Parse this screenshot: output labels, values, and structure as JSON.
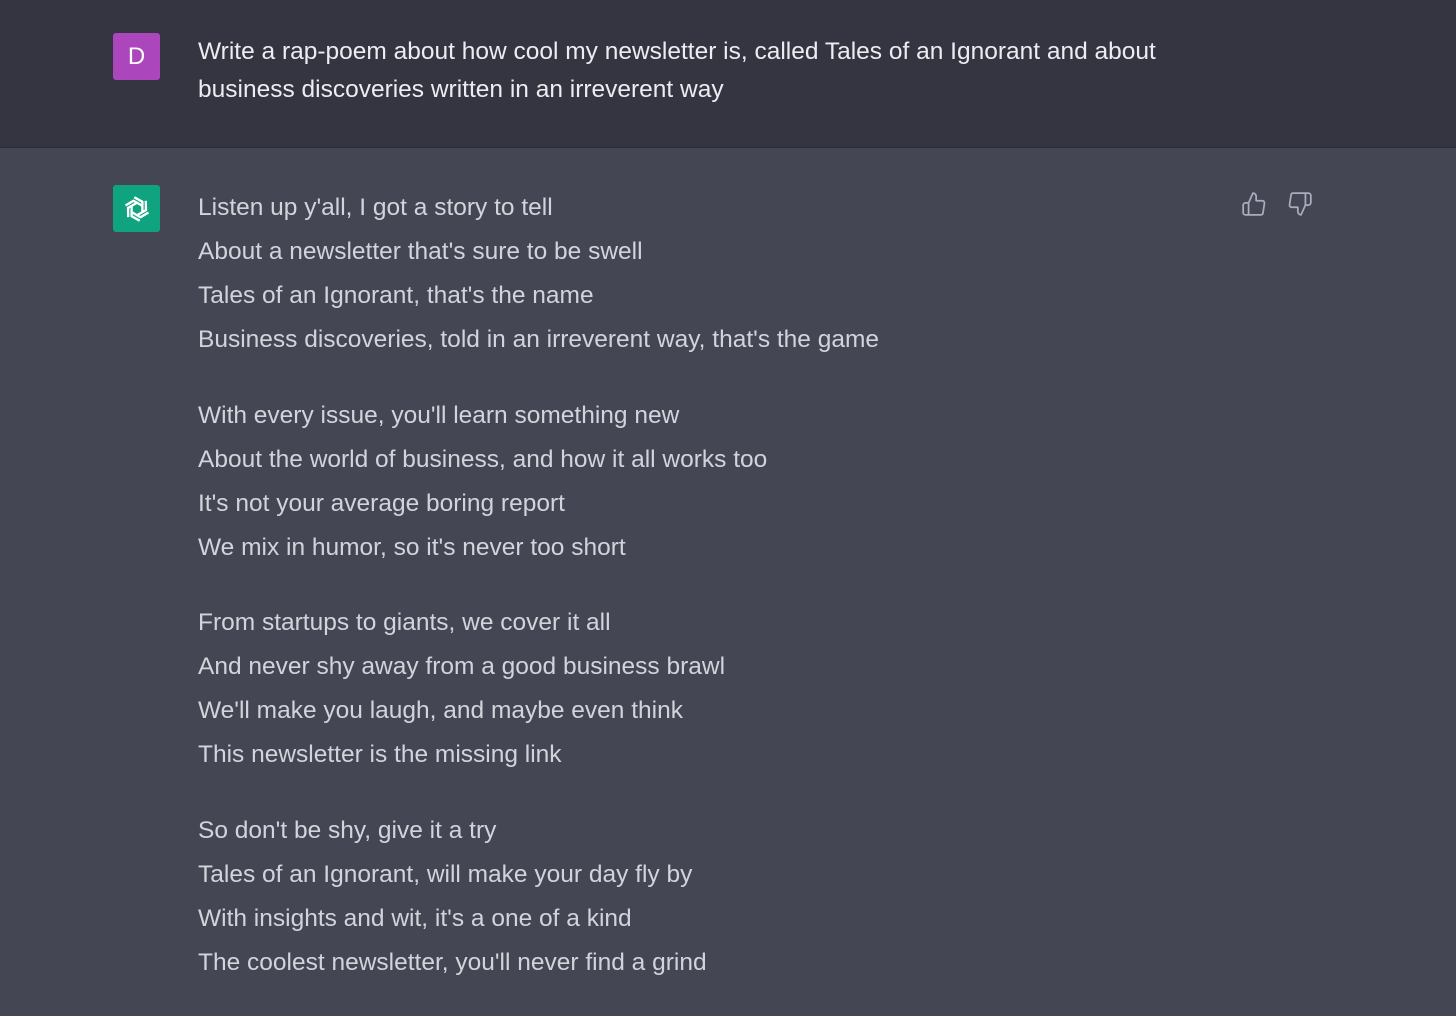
{
  "user_message": {
    "avatar_initial": "D",
    "avatar_color": "#ab46bc",
    "text": "Write a rap-poem about how cool my newsletter is, called Tales of an Ignorant and about business discoveries written in an irreverent way"
  },
  "assistant_message": {
    "avatar_icon": "openai-logo-icon",
    "avatar_color": "#10a37f",
    "stanzas": [
      {
        "lines": [
          "Listen up y'all, I got a story to tell",
          "About a newsletter that's sure to be swell",
          "Tales of an Ignorant, that's the name",
          "Business discoveries, told in an irreverent way, that's the game"
        ]
      },
      {
        "lines": [
          "With every issue, you'll learn something new",
          "About the world of business, and how it all works too",
          "It's not your average boring report",
          "We mix in humor, so it's never too short"
        ]
      },
      {
        "lines": [
          "From startups to giants, we cover it all",
          "And never shy away from a good business brawl",
          "We'll make you laugh, and maybe even think",
          "This newsletter is the missing link"
        ]
      },
      {
        "lines": [
          "So don't be shy, give it a try",
          "Tales of an Ignorant, will make your day fly by",
          "With insights and wit, it's a one of a kind",
          "The coolest newsletter, you'll never find a grind"
        ]
      }
    ],
    "feedback_icons": [
      "thumbs-up-icon",
      "thumbs-down-icon"
    ]
  }
}
